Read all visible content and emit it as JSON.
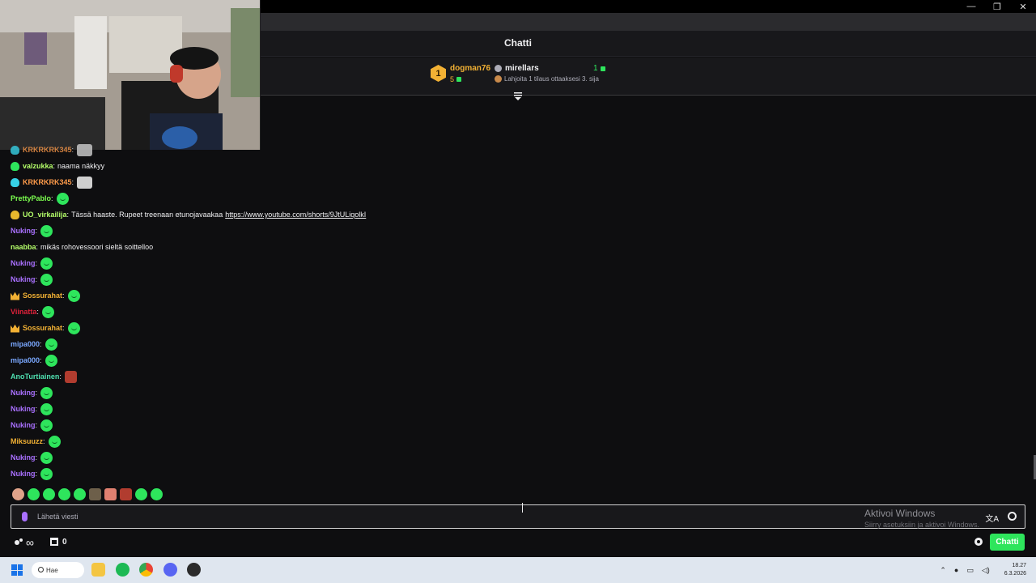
{
  "window": {
    "minimize": "—",
    "restore": "❐",
    "close": "✕"
  },
  "chat": {
    "title": "Chatti"
  },
  "leaderboard": {
    "first": {
      "rank": "1",
      "user": "dogman76",
      "count": "5"
    },
    "second": {
      "user": "mirellars",
      "count": "1"
    },
    "cta": "Lahjoita 1 tilaus ottaaksesi 3. sija"
  },
  "messages": [
    {
      "user": "KRKRKRK345",
      "color": "#ff9b4a",
      "badge": "cyan",
      "emote": "cat",
      "partial": true
    },
    {
      "user": "valzukka",
      "color": "#b5ff6a",
      "badge": "green",
      "text": "naama näkkyy"
    },
    {
      "user": "KRKRKRK345",
      "color": "#ff9b4a",
      "badge": "cyan",
      "emote": "cat"
    },
    {
      "user": "PrettyPablo",
      "color": "#7cff4f",
      "emote": "green"
    },
    {
      "user": "UO_virkailija",
      "color": "#b5ff6a",
      "badge": "gold",
      "text": "Tässä haaste. Rupeet treenaan etunojavaakaa",
      "link": "https://www.youtube.com/shorts/9JtULiqolkI"
    },
    {
      "user": "Nuking",
      "color": "#a970ff",
      "emote": "green"
    },
    {
      "user": "naabba",
      "color": "#b5ff6a",
      "text": "mikäs rohovessoori sieltä soittelloo"
    },
    {
      "user": "Nuking",
      "color": "#a970ff",
      "emote": "green"
    },
    {
      "user": "Nuking",
      "color": "#a970ff",
      "emote": "green"
    },
    {
      "user": "Sossurahat",
      "color": "#f2b134",
      "badge": "crown",
      "emote": "green"
    },
    {
      "user": "Viinatta",
      "color": "#e0213a",
      "emote": "green"
    },
    {
      "user": "Sossurahat",
      "color": "#f2b134",
      "badge": "crown",
      "emote": "green"
    },
    {
      "user": "mipa000",
      "color": "#7aa8ff",
      "emote": "green"
    },
    {
      "user": "mipa000",
      "color": "#7aa8ff",
      "emote": "green"
    },
    {
      "user": "AnoTurtiainen",
      "color": "#4fe0b0",
      "emote": "face"
    },
    {
      "user": "Nuking",
      "color": "#a970ff",
      "emote": "green"
    },
    {
      "user": "Nuking",
      "color": "#a970ff",
      "emote": "green"
    },
    {
      "user": "Nuking",
      "color": "#a970ff",
      "emote": "green"
    },
    {
      "user": "Miksuuzz",
      "color": "#f2b134",
      "emote": "green"
    },
    {
      "user": "Nuking",
      "color": "#a970ff",
      "emote": "green"
    },
    {
      "user": "Nuking",
      "color": "#a970ff",
      "emote": "green"
    }
  ],
  "input": {
    "placeholder": "Lähetä viesti"
  },
  "watermark": {
    "line1": "Aktivoi Windows",
    "line2": "Siirry asetuksiin ja aktivoi Windows."
  },
  "bottom": {
    "points": "∞",
    "store_count": "0",
    "send_label": "Chatti"
  },
  "taskbar": {
    "search_label": "Hae",
    "time": "18.27",
    "date": "6.3.2026"
  },
  "colors": {
    "accent": "#2ee55c",
    "background": "#0e0e10"
  }
}
